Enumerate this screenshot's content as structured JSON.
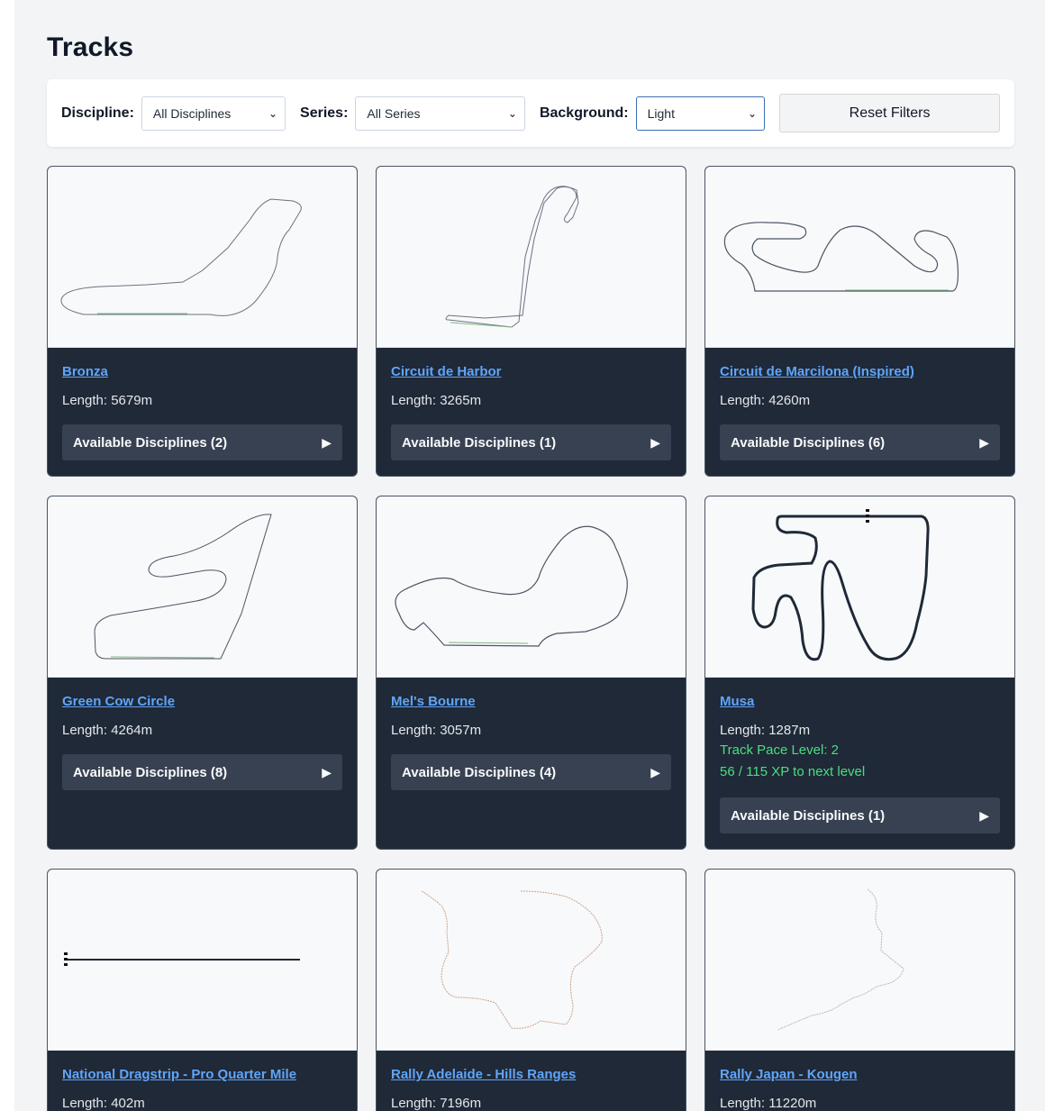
{
  "page": {
    "title": "Tracks"
  },
  "filters": {
    "discipline_label": "Discipline:",
    "discipline_value": "All Disciplines",
    "series_label": "Series:",
    "series_value": "All Series",
    "background_label": "Background:",
    "background_value": "Light",
    "reset_label": "Reset Filters"
  },
  "tracks": [
    {
      "name": "Bronza",
      "length": "Length: 5679m",
      "disciplines": "Available Disciplines (2)"
    },
    {
      "name": "Circuit de Harbor",
      "length": "Length: 3265m",
      "disciplines": "Available Disciplines (1)"
    },
    {
      "name": "Circuit de Marcilona (Inspired)",
      "length": "Length: 4260m",
      "disciplines": "Available Disciplines (6)"
    },
    {
      "name": "Green Cow Circle",
      "length": "Length: 4264m",
      "disciplines": "Available Disciplines (8)"
    },
    {
      "name": "Mel's Bourne",
      "length": "Length: 3057m",
      "disciplines": "Available Disciplines (4)"
    },
    {
      "name": "Musa",
      "length": "Length: 1287m",
      "pace_level": "Track Pace Level: 2",
      "xp": "56 / 115 XP to next level",
      "disciplines": "Available Disciplines (1)"
    },
    {
      "name": "National Dragstrip - Pro Quarter Mile",
      "length": "Length: 402m"
    },
    {
      "name": "Rally Adelaide - Hills Ranges",
      "length": "Length: 7196m"
    },
    {
      "name": "Rally Japan - Kougen",
      "length": "Length: 11220m"
    }
  ],
  "icons": {
    "select_chevron": "chevron-down-icon",
    "expand": "play-triangle-icon"
  },
  "colors": {
    "link": "#60a5fa",
    "pace": "#4ade80",
    "card_bg": "#1f2937",
    "button_bg": "#374151"
  }
}
